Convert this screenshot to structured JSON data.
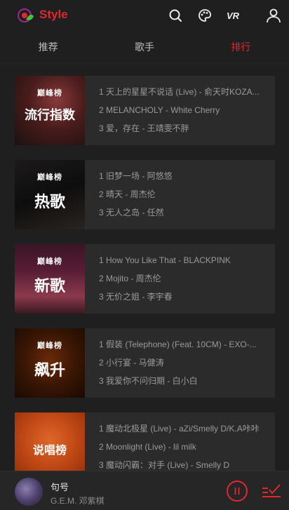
{
  "header": {
    "title": "Style",
    "icons": [
      "search-icon",
      "palette-icon",
      "vr-icon",
      "user-icon"
    ],
    "accent": "#e0282e"
  },
  "tabs": [
    {
      "label": "推荐",
      "active": false
    },
    {
      "label": "歌手",
      "active": false
    },
    {
      "label": "排行",
      "active": true
    }
  ],
  "charts": [
    {
      "badge": "巅峰榜",
      "name": "流行指数",
      "tracks": [
        "1 天上的星星不说话 (Live) - 俞天时KOZA...",
        "2 MELANCHOLY - White Cherry",
        "3 爱，存在 - 王靖雯不胖"
      ]
    },
    {
      "badge": "巅峰榜",
      "name": "热歌",
      "tracks": [
        "1 旧梦一场 - 阿悠悠",
        "2 晴天 - 周杰伦",
        "3 无人之岛 - 任然"
      ]
    },
    {
      "badge": "巅峰榜",
      "name": "新歌",
      "tracks": [
        "1 How You Like That - BLACKPINK",
        "2 Mojito - 周杰伦",
        "3 无价之姐 - 李宇春"
      ]
    },
    {
      "badge": "巅峰榜",
      "name": "飙升",
      "tracks": [
        "1 假装 (Telephone) (Feat. 10CM) - EXO-...",
        "2 小行宴 - 马健涛",
        "3 我爱你不问归期 - 白小白"
      ]
    },
    {
      "badge": "",
      "name": "说唱榜",
      "tracks": [
        "1 魔动北极星 (Live) - aZi/Smelly D/K.A咔咔",
        "2 Moonlight (Live) - lil milk",
        "3 魔动闪霸：对手 (Live) - Smelly D"
      ]
    }
  ],
  "player": {
    "song": "句号",
    "artist": "G.E.M. 邓紫棋",
    "state": "paused"
  }
}
